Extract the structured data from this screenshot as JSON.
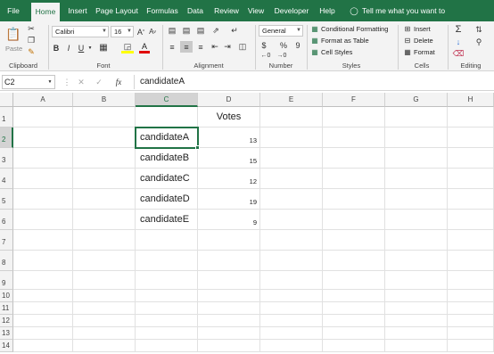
{
  "tabs": [
    {
      "label": "File",
      "active": false
    },
    {
      "label": "Home",
      "active": true
    },
    {
      "label": "Insert",
      "active": false
    },
    {
      "label": "Page Layout",
      "active": false
    },
    {
      "label": "Formulas",
      "active": false
    },
    {
      "label": "Data",
      "active": false
    },
    {
      "label": "Review",
      "active": false
    },
    {
      "label": "View",
      "active": false
    },
    {
      "label": "Developer",
      "active": false
    },
    {
      "label": "Help",
      "active": false
    }
  ],
  "tell_me": "Tell me what you want to do",
  "ribbon": {
    "clipboard": {
      "paste_label": "Paste",
      "group_label": "Clipboard"
    },
    "font": {
      "font_name": "Calibri",
      "font_size": "16",
      "bold": "B",
      "italic": "I",
      "underline": "U",
      "grow": "A",
      "shrink": "A",
      "group_label": "Font"
    },
    "alignment": {
      "group_label": "Alignment"
    },
    "number": {
      "format": "General",
      "currency": "$",
      "percent": "%",
      "comma": "9",
      "group_label": "Number"
    },
    "styles": {
      "conditional": "Conditional Formatting",
      "format_table": "Format as Table",
      "cell_styles": "Cell Styles",
      "group_label": "Styles"
    },
    "cells": {
      "insert": "Insert",
      "delete": "Delete",
      "format": "Format",
      "group_label": "Cells"
    },
    "editing": {
      "sum": "Σ",
      "group_label": "Editing"
    }
  },
  "formula_bar": {
    "name_box": "C2",
    "fx": "fx",
    "value": "candidateA"
  },
  "sheet": {
    "columns": [
      "A",
      "B",
      "C",
      "D",
      "E",
      "F",
      "G",
      "H"
    ],
    "rows": [
      "1",
      "2",
      "3",
      "4",
      "5",
      "6",
      "7",
      "8",
      "9",
      "10",
      "11",
      "12",
      "13",
      "14"
    ],
    "selected_cell": "C2",
    "header": "Votes",
    "candidates": [
      "candidateA",
      "candidateB",
      "candidateC",
      "candidateD",
      "candidateE"
    ],
    "votes": [
      "13",
      "15",
      "12",
      "19",
      "9"
    ]
  },
  "colors": {
    "accent": "#217346",
    "selection_header": "#d3d3d3"
  }
}
